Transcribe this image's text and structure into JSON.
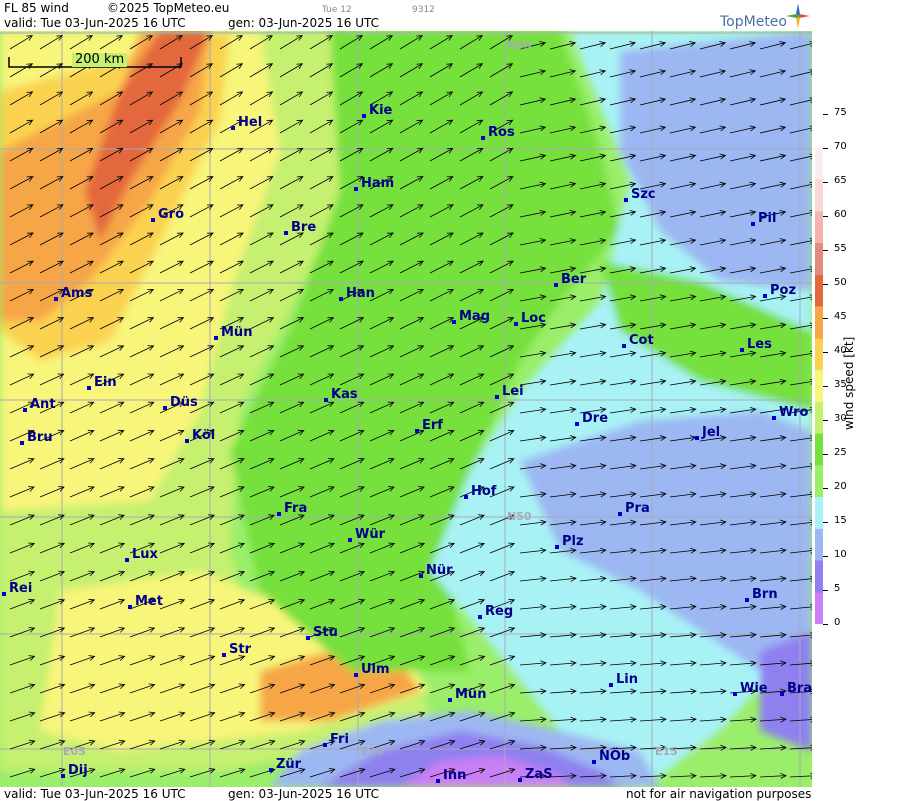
{
  "header": {
    "product": "FL 85 wind",
    "copyright": "©2025 TopMeteo.eu",
    "step": "Tue 12",
    "code": "9312",
    "valid": "valid:  Tue  03-Jun-2025  16 UTC",
    "gen": "gen: 03-Jun-2025 16 UTC",
    "logo": "TopMeteo"
  },
  "footer": {
    "valid": "valid:  Tue  03-Jun-2025  16 UTC",
    "gen": "gen: 03-Jun-2025 16 UTC",
    "disclaimer": "not for air navigation purposes"
  },
  "scale_label": "200 km",
  "grid_labels": [
    "N55",
    "N50",
    "E05",
    "E10",
    "E15"
  ],
  "cities": [
    "Hel",
    "Kie",
    "Ros",
    "Ham",
    "Szc",
    "Gro",
    "Bre",
    "Pil",
    "Ber",
    "Poz",
    "Ams",
    "Han",
    "Mag",
    "Loc",
    "Mün",
    "Cot",
    "Les",
    "Ein",
    "Kas",
    "Lei",
    "Wro",
    "Ant",
    "Düs",
    "Dre",
    "Jel",
    "Bru",
    "Köl",
    "Erf",
    "Hof",
    "Fra",
    "Pra",
    "Wür",
    "Plz",
    "Lux",
    "Nür",
    "Rei",
    "Met",
    "Reg",
    "Brn",
    "Stu",
    "Str",
    "Ulm",
    "Lin",
    "Mün",
    "Wie",
    "Bra",
    "Fri",
    "Zür",
    "NÖb",
    "Dij",
    "Inn",
    "ZaS"
  ],
  "legend": {
    "title": "wind speed  [kt]",
    "ticks": [
      "0",
      "5",
      "10",
      "15",
      "20",
      "25",
      "30",
      "35",
      "40",
      "45",
      "50",
      "55",
      "60",
      "65",
      "70",
      "75"
    ],
    "colors": [
      "#c97ff5",
      "#8f80f0",
      "#9cb7f2",
      "#a8f2f5",
      "#9aee6a",
      "#76e03c",
      "#c6f070",
      "#f7f57a",
      "#fbd24f",
      "#f6a646",
      "#e4683e",
      "#e38a7e",
      "#f2b4ad",
      "#f8d7d6",
      "#fbeeee"
    ]
  },
  "colors": {
    "city": "#00008b",
    "dot": "#0000cc",
    "grid": "#a9a9b8"
  }
}
